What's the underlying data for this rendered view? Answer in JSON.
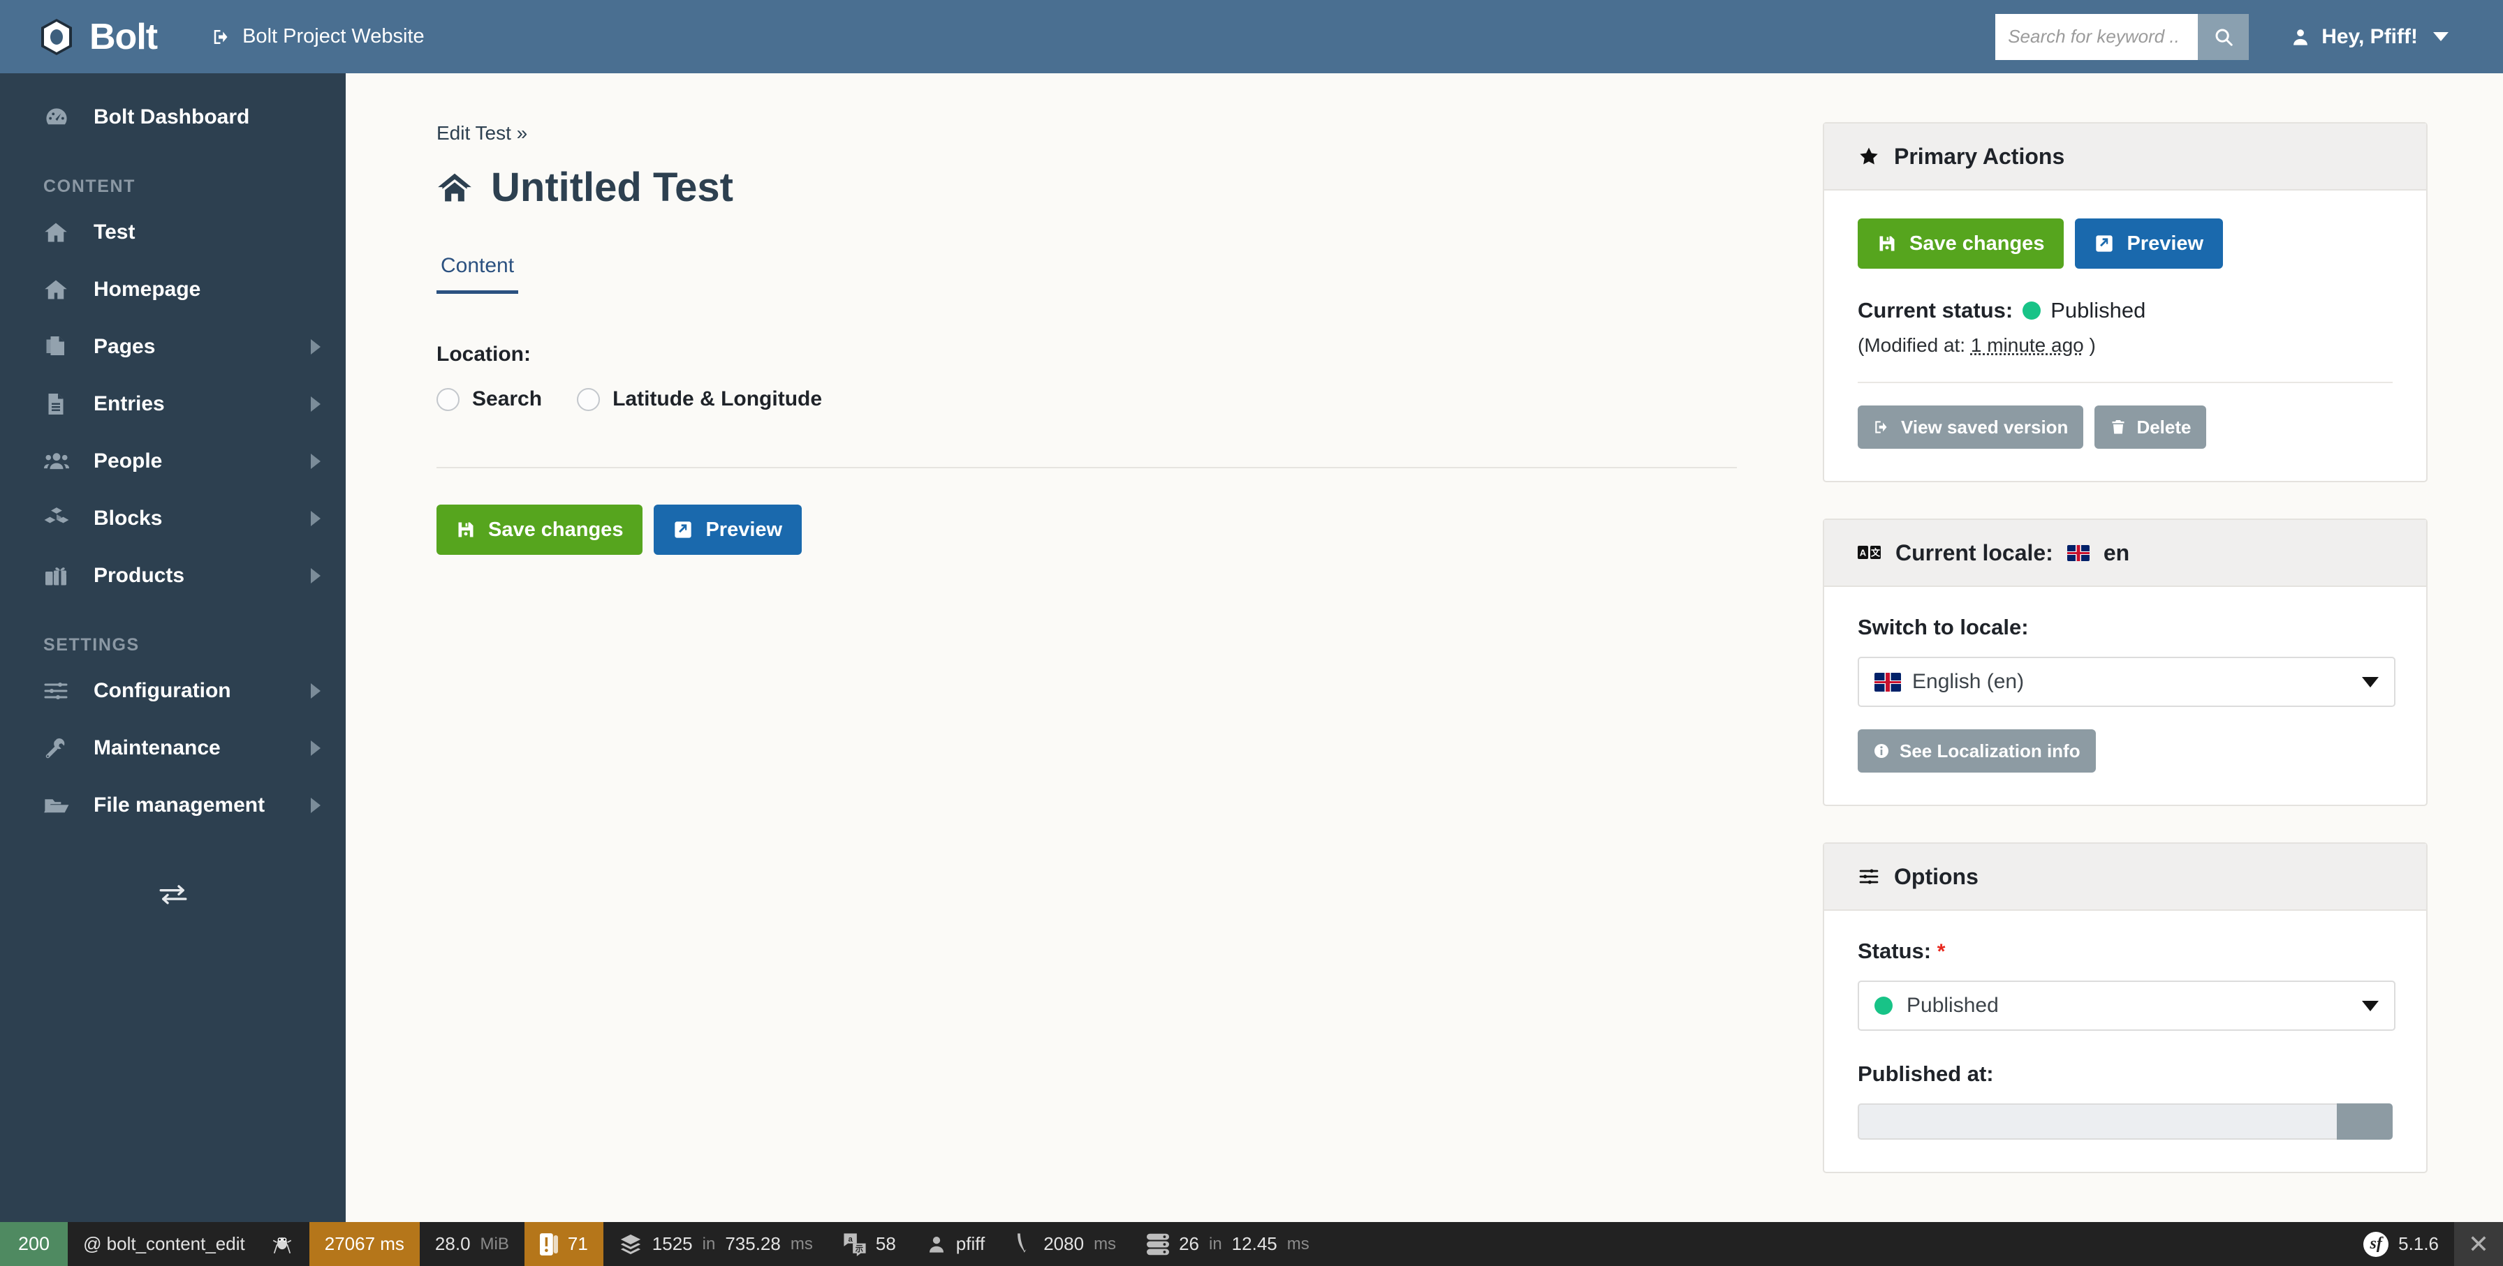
{
  "topbar": {
    "brand_name": "Bolt",
    "brand_logo_icon": "bolt-hex-logo-icon",
    "project_link_label": "Bolt Project Website",
    "project_link_icon": "external-link-icon",
    "search_placeholder": "Search for keyword ..",
    "search_value": "",
    "search_icon": "search-icon",
    "user_label": "Hey, Pfiff!",
    "user_icon": "user-icon",
    "caret_icon": "chevron-down-icon"
  },
  "sidebar": {
    "dashboard": {
      "label": "Bolt Dashboard",
      "icon": "gauge-icon"
    },
    "groups": [
      {
        "title": "CONTENT",
        "items": [
          {
            "label": "Test",
            "icon": "home-icon",
            "has_chevron": false
          },
          {
            "label": "Homepage",
            "icon": "home-icon",
            "has_chevron": false
          },
          {
            "label": "Pages",
            "icon": "copy-icon",
            "has_chevron": true
          },
          {
            "label": "Entries",
            "icon": "file-icon",
            "has_chevron": true
          },
          {
            "label": "People",
            "icon": "people-icon",
            "has_chevron": true
          },
          {
            "label": "Blocks",
            "icon": "blocks-icon",
            "has_chevron": true
          },
          {
            "label": "Products",
            "icon": "gift-icon",
            "has_chevron": true
          }
        ]
      },
      {
        "title": "SETTINGS",
        "items": [
          {
            "label": "Configuration",
            "icon": "sliders-icon",
            "has_chevron": true
          },
          {
            "label": "Maintenance",
            "icon": "tools-icon",
            "has_chevron": true
          },
          {
            "label": "File management",
            "icon": "folder-icon",
            "has_chevron": true
          }
        ]
      }
    ],
    "toggle_icon": "collapse-arrows-icon"
  },
  "main": {
    "breadcrumb": "Edit Test »",
    "title": "Untitled Test",
    "title_icon": "home-icon",
    "tabs": [
      {
        "label": "Content",
        "active": true
      }
    ],
    "location_label": "Location:",
    "location_options": [
      {
        "label": "Search",
        "selected": false
      },
      {
        "label": "Latitude & Longitude",
        "selected": false
      }
    ],
    "save_label": "Save changes",
    "save_icon": "save-icon",
    "preview_label": "Preview",
    "preview_icon": "external-arrow-icon"
  },
  "primary_actions": {
    "title": "Primary Actions",
    "icon": "star-icon",
    "save_label": "Save changes",
    "save_icon": "save-icon",
    "preview_label": "Preview",
    "preview_icon": "external-arrow-icon",
    "status_label": "Current status:",
    "status_value": "Published",
    "status_dot_color": "#18c387",
    "modified_prefix": "(Modified at: ",
    "modified_value": "1 minute ago",
    "modified_suffix": " )",
    "view_saved_label": "View saved version",
    "view_saved_icon": "external-link-icon",
    "delete_label": "Delete",
    "delete_icon": "trash-icon"
  },
  "locale_panel": {
    "title_prefix": "Current locale:",
    "title_icon": "translate-icon",
    "current_locale": "en",
    "flag_icon": "uk-flag-icon",
    "switch_label": "Switch to locale:",
    "selected_locale": "English (en)",
    "localization_button_label": "See Localization info",
    "localization_button_icon": "info-icon"
  },
  "options_panel": {
    "title": "Options",
    "icon": "sliders-icon",
    "status_label": "Status:",
    "status_required_mark": "*",
    "status_value": "Published",
    "status_dot_color": "#18c387",
    "published_at_label": "Published at:",
    "published_at_value": ""
  },
  "debugbar": {
    "http_status": "200",
    "route": "@ bolt_content_edit",
    "route_icon": "bug-icon",
    "time_ms": "27067 ms",
    "memory": "28.0",
    "memory_unit": "MiB",
    "warn_count": "71",
    "warn_icon": "logs-icon",
    "twig_icon": "layers-icon",
    "twig_count": "1525",
    "twig_in": "in",
    "twig_time": "735.28",
    "twig_unit": "ms",
    "translation_icon": "translation-icon",
    "translation_count": "58",
    "user_icon": "user-icon",
    "user_name": "pfiff",
    "forms_icon": "form-icon",
    "forms_time": "2080",
    "forms_unit": "ms",
    "db_icon": "database-icon",
    "db_count": "26",
    "db_in": "in",
    "db_time": "12.45",
    "db_unit": "ms",
    "sf_logo": "symfony-logo-icon",
    "sf_version": "5.1.6",
    "close_icon": "close-icon"
  },
  "colors": {
    "topbar": "#4a6f91",
    "sidebar": "#2d4050",
    "accent_blue": "#2b5180",
    "button_green": "#56a51e",
    "button_blue": "#1a69ad",
    "button_gray": "#8d9ba3",
    "status_green": "#18c387",
    "required_red": "#e8281e"
  }
}
